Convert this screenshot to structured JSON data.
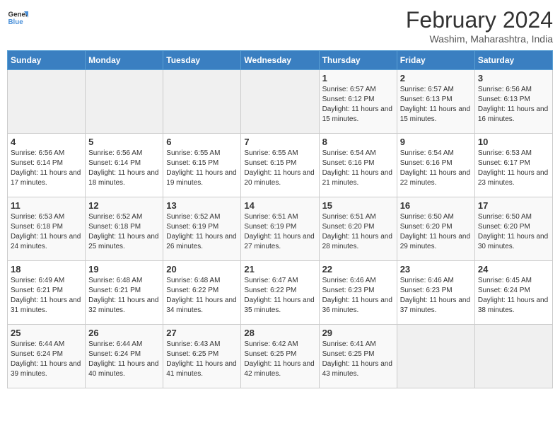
{
  "logo": {
    "text_general": "General",
    "text_blue": "Blue"
  },
  "title": "February 2024",
  "subtitle": "Washim, Maharashtra, India",
  "days_of_week": [
    "Sunday",
    "Monday",
    "Tuesday",
    "Wednesday",
    "Thursday",
    "Friday",
    "Saturday"
  ],
  "weeks": [
    [
      {
        "day": "",
        "info": ""
      },
      {
        "day": "",
        "info": ""
      },
      {
        "day": "",
        "info": ""
      },
      {
        "day": "",
        "info": ""
      },
      {
        "day": "1",
        "info": "Sunrise: 6:57 AM\nSunset: 6:12 PM\nDaylight: 11 hours and 15 minutes."
      },
      {
        "day": "2",
        "info": "Sunrise: 6:57 AM\nSunset: 6:13 PM\nDaylight: 11 hours and 15 minutes."
      },
      {
        "day": "3",
        "info": "Sunrise: 6:56 AM\nSunset: 6:13 PM\nDaylight: 11 hours and 16 minutes."
      }
    ],
    [
      {
        "day": "4",
        "info": "Sunrise: 6:56 AM\nSunset: 6:14 PM\nDaylight: 11 hours and 17 minutes."
      },
      {
        "day": "5",
        "info": "Sunrise: 6:56 AM\nSunset: 6:14 PM\nDaylight: 11 hours and 18 minutes."
      },
      {
        "day": "6",
        "info": "Sunrise: 6:55 AM\nSunset: 6:15 PM\nDaylight: 11 hours and 19 minutes."
      },
      {
        "day": "7",
        "info": "Sunrise: 6:55 AM\nSunset: 6:15 PM\nDaylight: 11 hours and 20 minutes."
      },
      {
        "day": "8",
        "info": "Sunrise: 6:54 AM\nSunset: 6:16 PM\nDaylight: 11 hours and 21 minutes."
      },
      {
        "day": "9",
        "info": "Sunrise: 6:54 AM\nSunset: 6:16 PM\nDaylight: 11 hours and 22 minutes."
      },
      {
        "day": "10",
        "info": "Sunrise: 6:53 AM\nSunset: 6:17 PM\nDaylight: 11 hours and 23 minutes."
      }
    ],
    [
      {
        "day": "11",
        "info": "Sunrise: 6:53 AM\nSunset: 6:18 PM\nDaylight: 11 hours and 24 minutes."
      },
      {
        "day": "12",
        "info": "Sunrise: 6:52 AM\nSunset: 6:18 PM\nDaylight: 11 hours and 25 minutes."
      },
      {
        "day": "13",
        "info": "Sunrise: 6:52 AM\nSunset: 6:19 PM\nDaylight: 11 hours and 26 minutes."
      },
      {
        "day": "14",
        "info": "Sunrise: 6:51 AM\nSunset: 6:19 PM\nDaylight: 11 hours and 27 minutes."
      },
      {
        "day": "15",
        "info": "Sunrise: 6:51 AM\nSunset: 6:20 PM\nDaylight: 11 hours and 28 minutes."
      },
      {
        "day": "16",
        "info": "Sunrise: 6:50 AM\nSunset: 6:20 PM\nDaylight: 11 hours and 29 minutes."
      },
      {
        "day": "17",
        "info": "Sunrise: 6:50 AM\nSunset: 6:20 PM\nDaylight: 11 hours and 30 minutes."
      }
    ],
    [
      {
        "day": "18",
        "info": "Sunrise: 6:49 AM\nSunset: 6:21 PM\nDaylight: 11 hours and 31 minutes."
      },
      {
        "day": "19",
        "info": "Sunrise: 6:48 AM\nSunset: 6:21 PM\nDaylight: 11 hours and 32 minutes."
      },
      {
        "day": "20",
        "info": "Sunrise: 6:48 AM\nSunset: 6:22 PM\nDaylight: 11 hours and 34 minutes."
      },
      {
        "day": "21",
        "info": "Sunrise: 6:47 AM\nSunset: 6:22 PM\nDaylight: 11 hours and 35 minutes."
      },
      {
        "day": "22",
        "info": "Sunrise: 6:46 AM\nSunset: 6:23 PM\nDaylight: 11 hours and 36 minutes."
      },
      {
        "day": "23",
        "info": "Sunrise: 6:46 AM\nSunset: 6:23 PM\nDaylight: 11 hours and 37 minutes."
      },
      {
        "day": "24",
        "info": "Sunrise: 6:45 AM\nSunset: 6:24 PM\nDaylight: 11 hours and 38 minutes."
      }
    ],
    [
      {
        "day": "25",
        "info": "Sunrise: 6:44 AM\nSunset: 6:24 PM\nDaylight: 11 hours and 39 minutes."
      },
      {
        "day": "26",
        "info": "Sunrise: 6:44 AM\nSunset: 6:24 PM\nDaylight: 11 hours and 40 minutes."
      },
      {
        "day": "27",
        "info": "Sunrise: 6:43 AM\nSunset: 6:25 PM\nDaylight: 11 hours and 41 minutes."
      },
      {
        "day": "28",
        "info": "Sunrise: 6:42 AM\nSunset: 6:25 PM\nDaylight: 11 hours and 42 minutes."
      },
      {
        "day": "29",
        "info": "Sunrise: 6:41 AM\nSunset: 6:25 PM\nDaylight: 11 hours and 43 minutes."
      },
      {
        "day": "",
        "info": ""
      },
      {
        "day": "",
        "info": ""
      }
    ]
  ]
}
